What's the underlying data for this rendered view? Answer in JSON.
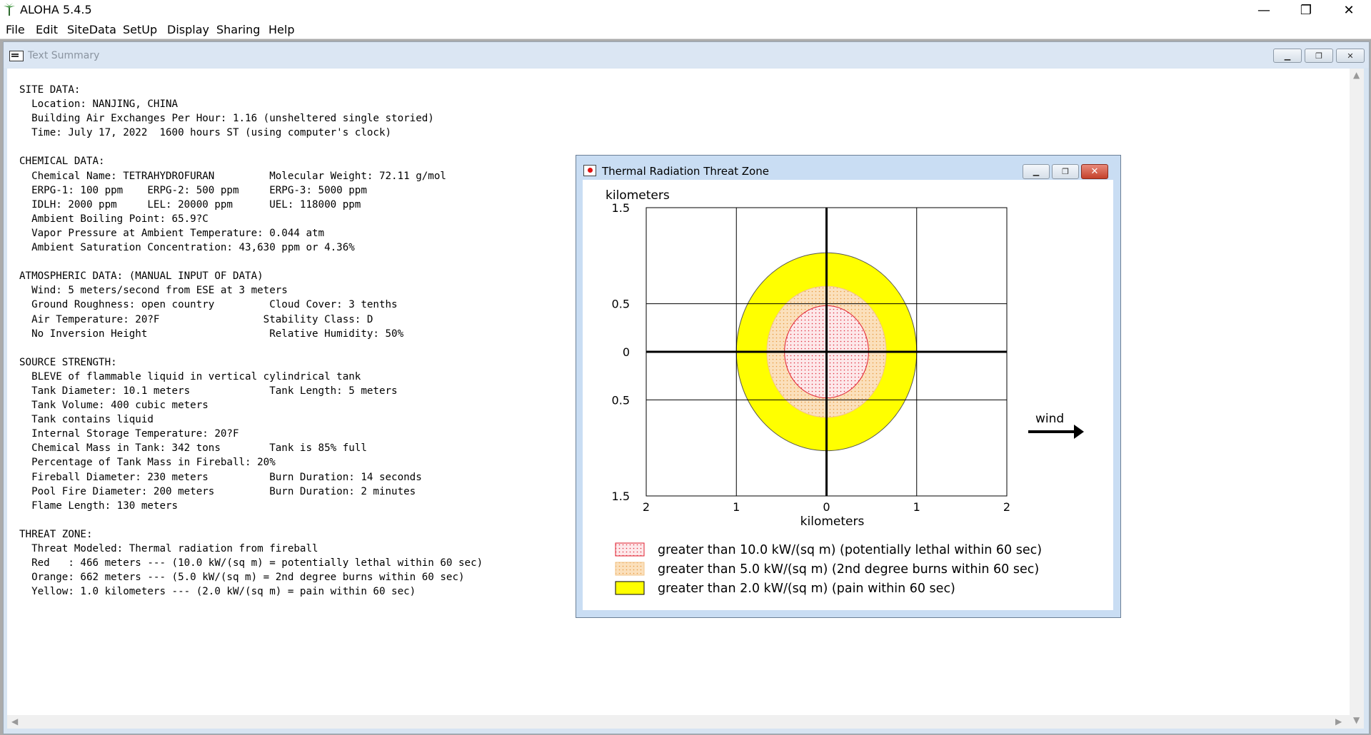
{
  "app": {
    "title": "ALOHA 5.4.5",
    "controls": {
      "minimize": "—",
      "restore": "❐",
      "close": "✕"
    }
  },
  "menu": {
    "items": [
      "File",
      "Edit",
      "SiteData",
      "SetUp",
      "Display",
      "Sharing",
      "Help"
    ]
  },
  "text_summary": {
    "title": "Text Summary",
    "lines": [
      "SITE DATA:",
      "  Location: NANJING, CHINA",
      "  Building Air Exchanges Per Hour: 1.16 (unsheltered single storied)",
      "  Time: July 17, 2022  1600 hours ST (using computer's clock)",
      "",
      "CHEMICAL DATA:",
      "  Chemical Name: TETRAHYDROFURAN         Molecular Weight: 72.11 g/mol",
      "  ERPG-1: 100 ppm    ERPG-2: 500 ppm     ERPG-3: 5000 ppm",
      "  IDLH: 2000 ppm     LEL: 20000 ppm      UEL: 118000 ppm",
      "  Ambient Boiling Point: 65.9?C",
      "  Vapor Pressure at Ambient Temperature: 0.044 atm",
      "  Ambient Saturation Concentration: 43,630 ppm or 4.36%",
      "",
      "ATMOSPHERIC DATA: (MANUAL INPUT OF DATA)",
      "  Wind: 5 meters/second from ESE at 3 meters",
      "  Ground Roughness: open country         Cloud Cover: 3 tenths",
      "  Air Temperature: 20?F                 Stability Class: D",
      "  No Inversion Height                    Relative Humidity: 50%",
      "",
      "SOURCE STRENGTH:",
      "  BLEVE of flammable liquid in vertical cylindrical tank",
      "  Tank Diameter: 10.1 meters             Tank Length: 5 meters",
      "  Tank Volume: 400 cubic meters",
      "  Tank contains liquid",
      "  Internal Storage Temperature: 20?F",
      "  Chemical Mass in Tank: 342 tons        Tank is 85% full",
      "  Percentage of Tank Mass in Fireball: 20%",
      "  Fireball Diameter: 230 meters          Burn Duration: 14 seconds",
      "  Pool Fire Diameter: 200 meters         Burn Duration: 2 minutes",
      "  Flame Length: 130 meters",
      "",
      "THREAT ZONE:",
      "  Threat Modeled: Thermal radiation from fireball",
      "  Red   : 466 meters --- (10.0 kW/(sq m) = potentially lethal within 60 sec)",
      "  Orange: 662 meters --- (5.0 kW/(sq m) = 2nd degree burns within 60 sec)",
      "  Yellow: 1.0 kilometers --- (2.0 kW/(sq m) = pain within 60 sec)"
    ]
  },
  "threat_zone_window": {
    "title": "Thermal Radiation Threat Zone",
    "wind_label": "wind"
  },
  "chart_data": {
    "type": "threat-zone-plot",
    "ylabel": "kilometers",
    "xlabel": "kilometers",
    "x_ticks": [
      "2",
      "1",
      "0",
      "1",
      "2"
    ],
    "x_tick_values": [
      -2,
      -1,
      0,
      1,
      2
    ],
    "y_ticks": [
      "1.5",
      "0.5",
      "0",
      "0.5",
      "1.5"
    ],
    "y_tick_values": [
      1.5,
      0.5,
      0,
      -0.5,
      -1.5
    ],
    "xlim": [
      -2,
      2
    ],
    "ylim": [
      -1.5,
      1.5
    ],
    "grid": true,
    "zones": [
      {
        "label": "greater than 2.0 kW/(sq m) (pain within 60 sec)",
        "radius_km": 1.0,
        "color": "#ffff00",
        "pattern": "solid"
      },
      {
        "label": "greater than 5.0 kW/(sq m) (2nd degree burns within 60 sec)",
        "radius_km": 0.662,
        "color": "#f7d9b0",
        "pattern": "dots-orange"
      },
      {
        "label": "greater than 10.0 kW/(sq m) (potentially lethal within 60 sec)",
        "radius_km": 0.466,
        "color": "#fbe3e6",
        "pattern": "dots-red"
      }
    ],
    "legend": [
      {
        "label": "greater than 10.0 kW/(sq m) (potentially lethal within 60 sec)",
        "pattern": "dots-red"
      },
      {
        "label": "greater than 5.0 kW/(sq m) (2nd degree burns within 60 sec)",
        "pattern": "dots-orange"
      },
      {
        "label": "greater than 2.0 kW/(sq m) (pain within 60 sec)",
        "pattern": "solid-yellow"
      }
    ]
  }
}
